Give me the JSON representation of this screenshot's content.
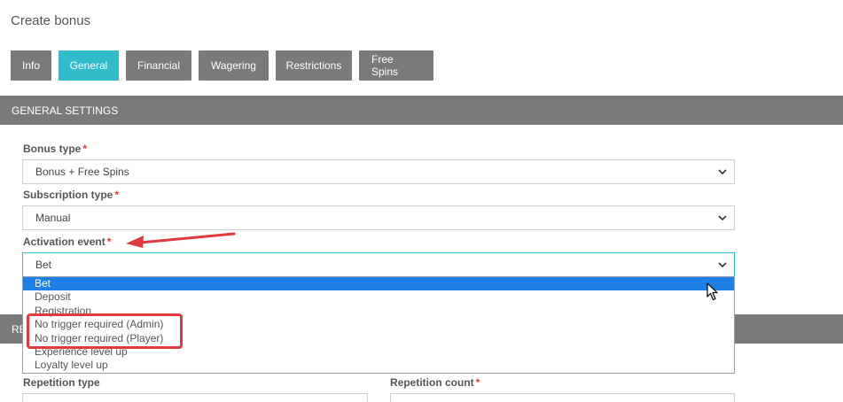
{
  "page": {
    "title": "Create bonus"
  },
  "tabs": [
    {
      "label": "Info",
      "active": false
    },
    {
      "label": "General",
      "active": true
    },
    {
      "label": "Financial",
      "active": false
    },
    {
      "label": "Wagering",
      "active": false
    },
    {
      "label": "Restrictions",
      "active": false
    },
    {
      "label": "Free Spins",
      "active": false
    }
  ],
  "general_settings": {
    "header": "GENERAL SETTINGS",
    "bonus_type": {
      "label": "Bonus type",
      "required_mark": "*",
      "value": "Bonus + Free Spins"
    },
    "subscription_type": {
      "label": "Subscription type",
      "required_mark": "*",
      "value": "Manual"
    },
    "activation_event": {
      "label": "Activation event",
      "required_mark": "*",
      "value": "Bet",
      "options": [
        "Bet",
        "Deposit",
        "Registration",
        "No trigger required (Admin)",
        "No trigger required (Player)",
        "Experience level up",
        "Loyalty level up"
      ],
      "selected_index": 0
    }
  },
  "repetition": {
    "header_partial": "RE",
    "repetition_type": {
      "label": "Repetition type"
    },
    "repetition_count": {
      "label": "Repetition count",
      "required_mark": "*"
    }
  },
  "colors": {
    "tab_default": "#7a7a7a",
    "tab_active": "#31bccb",
    "option_selected": "#1e7fe6",
    "annotation": "#e0393e",
    "required": "#e03a3a"
  },
  "icons": {
    "chevron": "chevron-down-icon",
    "cursor": "mouse-pointer-icon",
    "annotation_arrow": "arrow-left-icon"
  }
}
